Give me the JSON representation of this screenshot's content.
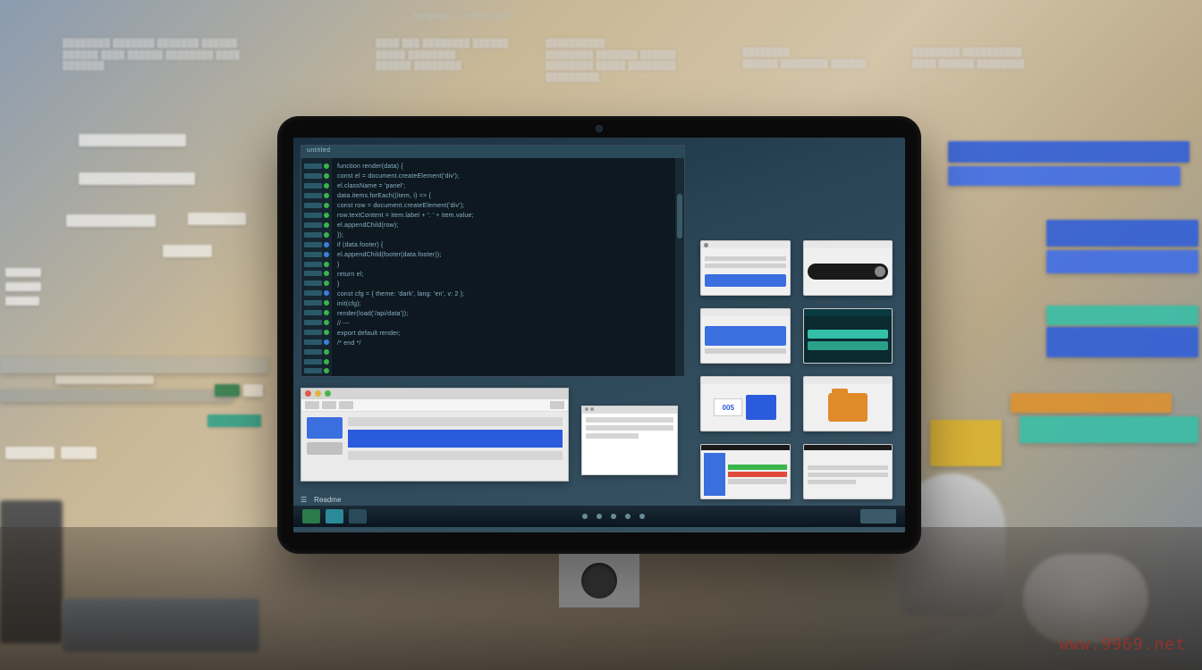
{
  "watermark": "www.9969.net",
  "monitor": {
    "code_editor": {
      "title_bar": "untitled",
      "lines": [
        "function render(data) {",
        "  const el = document.createElement('div');",
        "  el.className = 'panel';",
        "  data.items.forEach((item, i) => {",
        "    const row = document.createElement('div');",
        "    row.textContent = item.label + ': ' + item.value;",
        "    el.appendChild(row);",
        "  });",
        "  if (data.footer) {",
        "    el.appendChild(footer(data.footer));",
        "  }",
        "  return el;",
        "}",
        "",
        "const cfg = { theme: 'dark', lang: 'en', v: 2 };",
        "init(cfg);",
        "render(load('/api/data'));",
        "// ---",
        "export default render;",
        "/* end */",
        "",
        ""
      ],
      "gutter_markers": [
        "green",
        "green",
        "green",
        "green",
        "green",
        "green",
        "green",
        "green",
        "blue",
        "blue",
        "green",
        "green",
        "green",
        "blue",
        "green",
        "green",
        "green",
        "green",
        "blue",
        "green",
        "green",
        "green"
      ]
    },
    "thumbnails": [
      {
        "kind": "form-preview",
        "accent": "#d9d9d9"
      },
      {
        "kind": "search-preview",
        "accent": "#1a1a1a"
      },
      {
        "kind": "card-preview",
        "accent": "#3b6fe0"
      },
      {
        "kind": "panel-preview",
        "accent": "#34c0a8"
      },
      {
        "kind": "badge-preview",
        "badge_text": "005",
        "accent": "#2a5bdc"
      },
      {
        "kind": "folder-preview",
        "accent": "#e08a2a"
      },
      {
        "kind": "layout-preview",
        "accent": "#3b6fe0"
      },
      {
        "kind": "doc-preview",
        "accent": "#d0d0d0"
      }
    ],
    "bottom_window": {
      "toolbar_items": [
        "",
        "",
        "",
        ""
      ],
      "chart_like": true
    },
    "readme_label": "Readme"
  },
  "background": {
    "top_center_label": "Template · DeTemplate",
    "floating_chips_count": 30
  }
}
